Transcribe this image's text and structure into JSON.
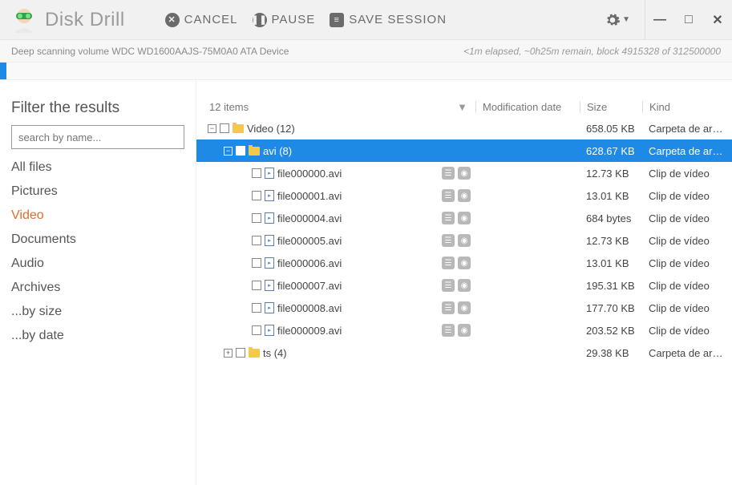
{
  "app": {
    "title": "Disk Drill"
  },
  "toolbar": {
    "cancel": "CANCEL",
    "pause": "PAUSE",
    "save_session": "SAVE SESSION"
  },
  "status": {
    "left": "Deep scanning volume WDC WD1600AAJS-75M0A0 ATA Device",
    "right": "<1m elapsed, ~0h25m remain, block 4915328 of 312500000"
  },
  "sidebar": {
    "title": "Filter the results",
    "search_placeholder": "search by name...",
    "filters": [
      "All files",
      "Pictures",
      "Video",
      "Documents",
      "Audio",
      "Archives",
      "...by size",
      "...by date"
    ],
    "active_index": 2
  },
  "columns": {
    "count_label": "12 items",
    "date": "Modification date",
    "size": "Size",
    "kind": "Kind"
  },
  "tree": [
    {
      "type": "folder",
      "indent": 0,
      "expand": "minus",
      "name": "Video (12)",
      "size": "658.05 KB",
      "kind": "Carpeta de arc...",
      "selected": false
    },
    {
      "type": "folder",
      "indent": 1,
      "expand": "minus",
      "name": "avi (8)",
      "size": "628.67 KB",
      "kind": "Carpeta de arc...",
      "selected": true
    },
    {
      "type": "file",
      "indent": 2,
      "name": "file000000.avi",
      "size": "12.73 KB",
      "kind": "Clip de vídeo"
    },
    {
      "type": "file",
      "indent": 2,
      "name": "file000001.avi",
      "size": "13.01 KB",
      "kind": "Clip de vídeo"
    },
    {
      "type": "file",
      "indent": 2,
      "name": "file000004.avi",
      "size": "684 bytes",
      "kind": "Clip de vídeo"
    },
    {
      "type": "file",
      "indent": 2,
      "name": "file000005.avi",
      "size": "12.73 KB",
      "kind": "Clip de vídeo"
    },
    {
      "type": "file",
      "indent": 2,
      "name": "file000006.avi",
      "size": "13.01 KB",
      "kind": "Clip de vídeo"
    },
    {
      "type": "file",
      "indent": 2,
      "name": "file000007.avi",
      "size": "195.31 KB",
      "kind": "Clip de vídeo"
    },
    {
      "type": "file",
      "indent": 2,
      "name": "file000008.avi",
      "size": "177.70 KB",
      "kind": "Clip de vídeo"
    },
    {
      "type": "file",
      "indent": 2,
      "name": "file000009.avi",
      "size": "203.52 KB",
      "kind": "Clip de vídeo"
    },
    {
      "type": "folder",
      "indent": 1,
      "expand": "plus",
      "name": "ts (4)",
      "size": "29.38 KB",
      "kind": "Carpeta de arc...",
      "selected": false
    }
  ]
}
